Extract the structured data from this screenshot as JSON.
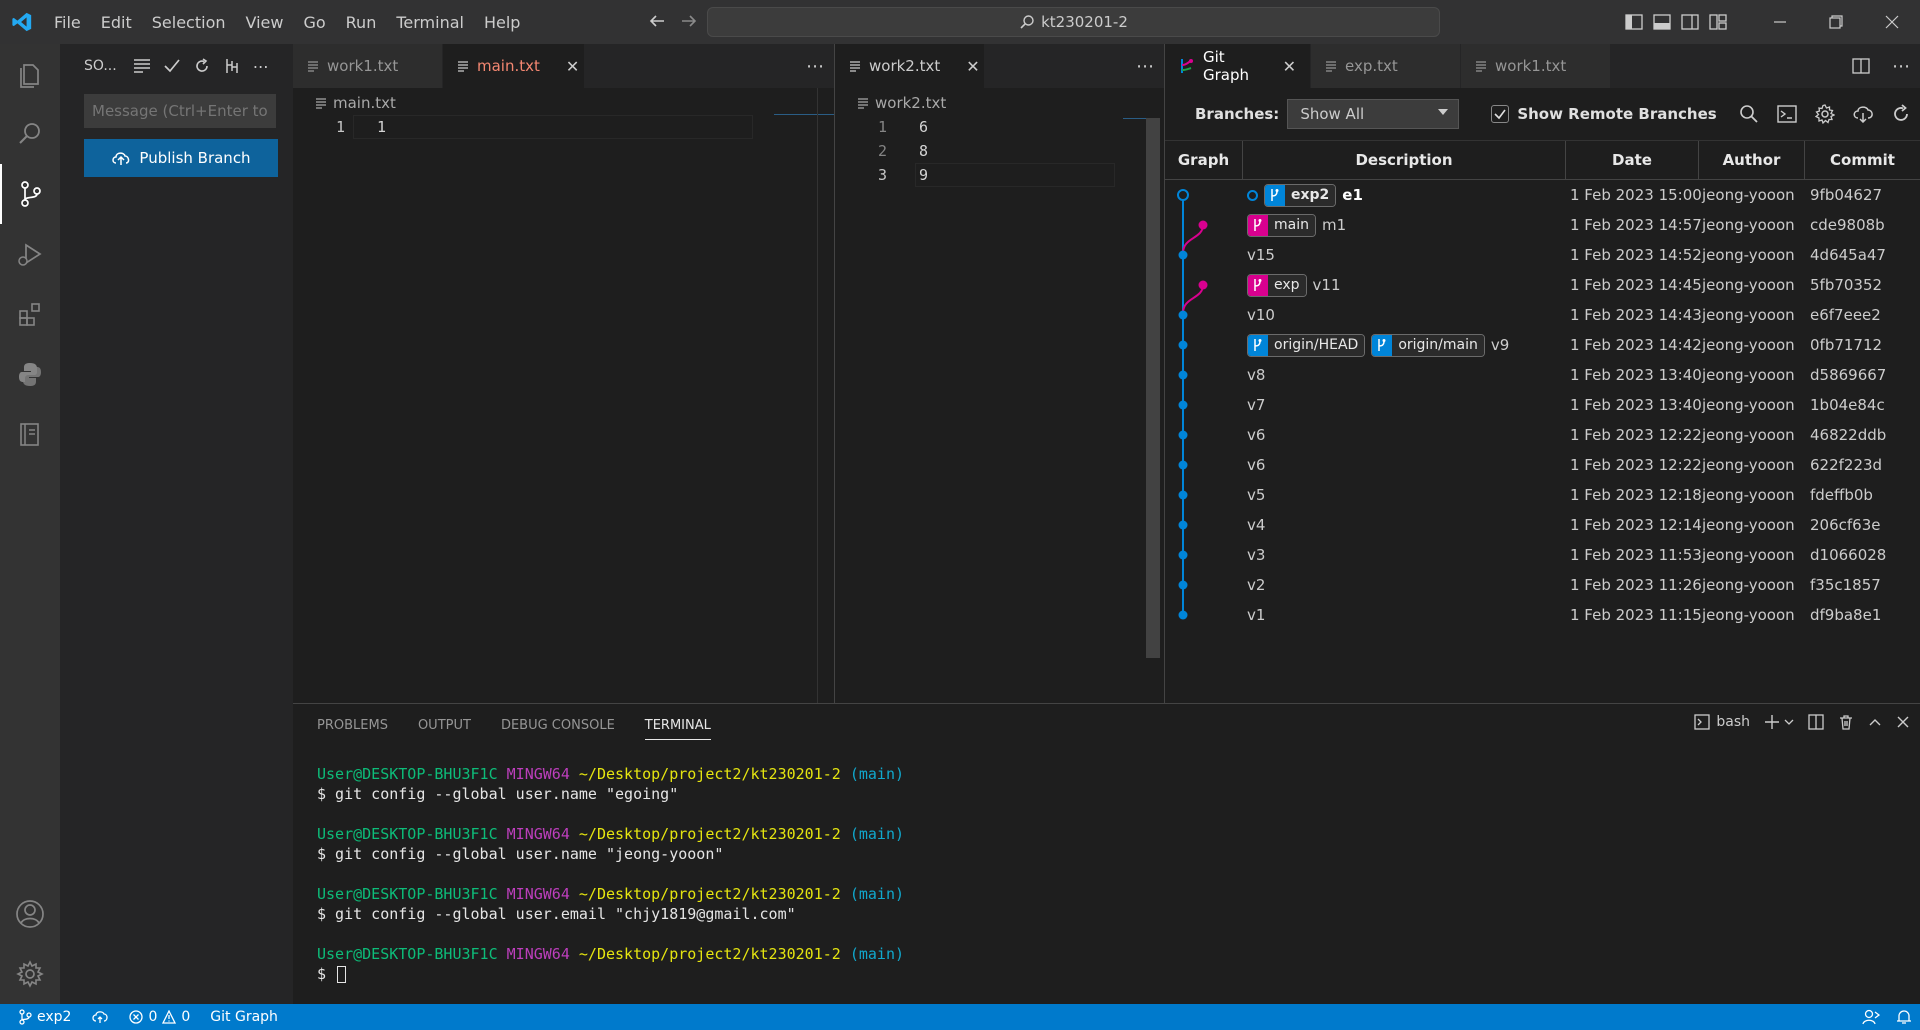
{
  "menu": [
    "File",
    "Edit",
    "Selection",
    "View",
    "Go",
    "Run",
    "Terminal",
    "Help"
  ],
  "command_center": {
    "label": "kt230201-2"
  },
  "sidebar": {
    "title": "SO...",
    "commit_placeholder": "Message (Ctrl+Enter to...",
    "publish_label": "Publish Branch"
  },
  "editor_group1": {
    "tabs": [
      {
        "label": "work1.txt",
        "active": false
      },
      {
        "label": "main.txt",
        "active": true
      }
    ],
    "breadcrumb": "main.txt",
    "lines": [
      {
        "num": "1",
        "text": "1"
      }
    ]
  },
  "editor_group2": {
    "tabs": [
      {
        "label": "work2.txt",
        "active": true
      }
    ],
    "breadcrumb": "work2.txt",
    "lines": [
      {
        "num": "1",
        "text": "6"
      },
      {
        "num": "2",
        "text": "8"
      },
      {
        "num": "3",
        "text": "9"
      }
    ]
  },
  "editor_group3": {
    "tabs": [
      {
        "label": "Git Graph",
        "active": true
      },
      {
        "label": "exp.txt",
        "active": false
      },
      {
        "label": "work1.txt",
        "active": false
      }
    ]
  },
  "git_graph": {
    "branches_label": "Branches:",
    "branch_select": "Show All",
    "remote_label": "Show Remote Branches",
    "remote_checked": true,
    "columns": [
      "Graph",
      "Description",
      "Date",
      "Author",
      "Commit"
    ],
    "commits": [
      {
        "refs": [
          {
            "name": "exp2",
            "color": "blue",
            "head": true
          }
        ],
        "message": "e1",
        "bold": true,
        "date": "1 Feb 2023 15:00",
        "author": "jeong-yooon",
        "hash": "9fb04627"
      },
      {
        "refs": [
          {
            "name": "main",
            "color": "pink",
            "head": false
          }
        ],
        "message": "m1",
        "bold": false,
        "date": "1 Feb 2023 14:57",
        "author": "jeong-yooon",
        "hash": "cde9808b"
      },
      {
        "refs": [],
        "message": "v15",
        "bold": false,
        "date": "1 Feb 2023 14:52",
        "author": "jeong-yooon",
        "hash": "4d645a47"
      },
      {
        "refs": [
          {
            "name": "exp",
            "color": "pink",
            "head": false
          }
        ],
        "message": "v11",
        "bold": false,
        "date": "1 Feb 2023 14:45",
        "author": "jeong-yooon",
        "hash": "5fb70352"
      },
      {
        "refs": [],
        "message": "v10",
        "bold": false,
        "date": "1 Feb 2023 14:43",
        "author": "jeong-yooon",
        "hash": "e6f7eee2"
      },
      {
        "refs": [
          {
            "name": "origin/HEAD",
            "color": "blue",
            "head": false
          },
          {
            "name": "origin/main",
            "color": "blue",
            "head": false
          }
        ],
        "message": "v9",
        "bold": false,
        "date": "1 Feb 2023 14:42",
        "author": "jeong-yooon",
        "hash": "0fb71712"
      },
      {
        "refs": [],
        "message": "v8",
        "bold": false,
        "date": "1 Feb 2023 13:40",
        "author": "jeong-yooon",
        "hash": "d5869667"
      },
      {
        "refs": [],
        "message": "v7",
        "bold": false,
        "date": "1 Feb 2023 13:40",
        "author": "jeong-yooon",
        "hash": "1b04e84c"
      },
      {
        "refs": [],
        "message": "v6",
        "bold": false,
        "date": "1 Feb 2023 12:22",
        "author": "jeong-yooon",
        "hash": "46822ddb"
      },
      {
        "refs": [],
        "message": "v6",
        "bold": false,
        "date": "1 Feb 2023 12:22",
        "author": "jeong-yooon",
        "hash": "622f223d"
      },
      {
        "refs": [],
        "message": "v5",
        "bold": false,
        "date": "1 Feb 2023 12:18",
        "author": "jeong-yooon",
        "hash": "fdeffb0b"
      },
      {
        "refs": [],
        "message": "v4",
        "bold": false,
        "date": "1 Feb 2023 12:14",
        "author": "jeong-yooon",
        "hash": "206cf63e"
      },
      {
        "refs": [],
        "message": "v3",
        "bold": false,
        "date": "1 Feb 2023 11:53",
        "author": "jeong-yooon",
        "hash": "d1066028"
      },
      {
        "refs": [],
        "message": "v2",
        "bold": false,
        "date": "1 Feb 2023 11:26",
        "author": "jeong-yooon",
        "hash": "f35c1857"
      },
      {
        "refs": [],
        "message": "v1",
        "bold": false,
        "date": "1 Feb 2023 11:15",
        "author": "jeong-yooon",
        "hash": "df9ba8e1"
      }
    ]
  },
  "panel": {
    "tabs": [
      {
        "label": "PROBLEMS",
        "active": false
      },
      {
        "label": "OUTPUT",
        "active": false
      },
      {
        "label": "DEBUG CONSOLE",
        "active": false
      },
      {
        "label": "TERMINAL",
        "active": true
      }
    ],
    "shell": "bash",
    "terminal": [
      {
        "user": "User@DESKTOP-BHU3F1C",
        "ming": "MINGW64",
        "path": "~/Desktop/project2/kt230201-2",
        "branch": "(main)",
        "cmd": "$ git config --global user.name \"egoing\""
      },
      {
        "user": "User@DESKTOP-BHU3F1C",
        "ming": "MINGW64",
        "path": "~/Desktop/project2/kt230201-2",
        "branch": "(main)",
        "cmd": "$ git config --global user.name \"jeong-yooon\""
      },
      {
        "user": "User@DESKTOP-BHU3F1C",
        "ming": "MINGW64",
        "path": "~/Desktop/project2/kt230201-2",
        "branch": "(main)",
        "cmd": "$ git config --global user.email \"chjy1819@gmail.com\""
      },
      {
        "user": "User@DESKTOP-BHU3F1C",
        "ming": "MINGW64",
        "path": "~/Desktop/project2/kt230201-2",
        "branch": "(main)",
        "cmd": "$ "
      }
    ]
  },
  "statusbar": {
    "branch": "exp2",
    "errors": "0",
    "warnings": "0",
    "git_graph": "Git Graph"
  },
  "colors": {
    "accent": "#007acc",
    "button": "#0e639c",
    "graph_blue": "#0085d9",
    "graph_pink": "#d9008f"
  }
}
